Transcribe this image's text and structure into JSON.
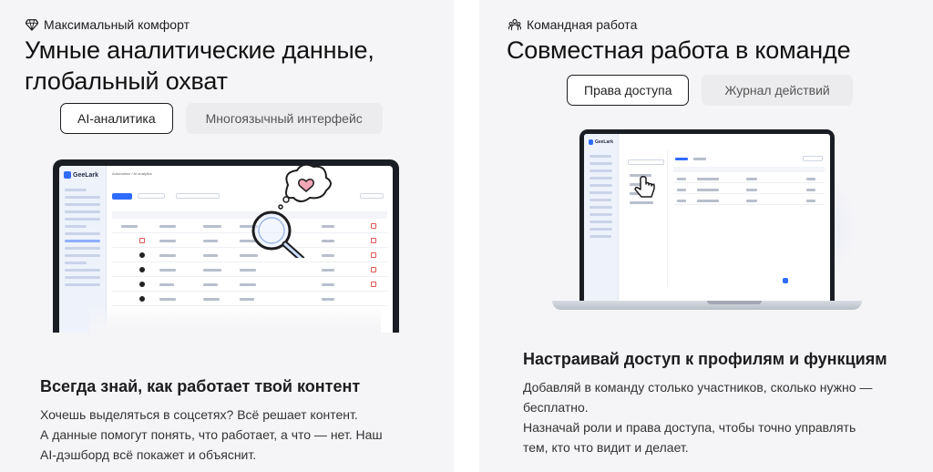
{
  "left_card": {
    "eyebrow": "Максимальный комфорт",
    "headline_line1": "Умные аналитические данные,",
    "headline_line2": "глобальный охват",
    "tabs": [
      {
        "label": "AI-аналитика",
        "active": true
      },
      {
        "label": "Многоязычный интерфейс",
        "active": false
      }
    ],
    "subheading": "Всегда знай, как работает твой контент",
    "body_line1": "Хочешь выделяться в соцсетях? Всё решает контент.",
    "body_line2": "А данные помогут понять, что работает, а что — нет. Наш",
    "body_line3": "AI-дэшборд всё покажет и объяснит.",
    "mock": {
      "logo": "GeeLark",
      "breadcrumb": "Automation / AI analytics"
    }
  },
  "right_card": {
    "eyebrow": "Командная работа",
    "headline": "Совместная работа в команде",
    "tabs": [
      {
        "label": "Права доступа",
        "active": true
      },
      {
        "label": "Журнал действий",
        "active": false
      }
    ],
    "subheading": "Настраивай доступ к профилям и функциям",
    "body_line1": "Добавляй в команду столько участников, сколько нужно —",
    "body_line2": "бесплатно.",
    "body_line3": "Назначай роли и права доступа, чтобы точно управлять",
    "body_line4": "тем, кто что видит и делает.",
    "mock": {
      "logo": "GeeLark"
    }
  },
  "colors": {
    "card_bg": "#f5f5f7",
    "accent_blue": "#2f6bff",
    "laptop_frame": "#1a1d24"
  }
}
